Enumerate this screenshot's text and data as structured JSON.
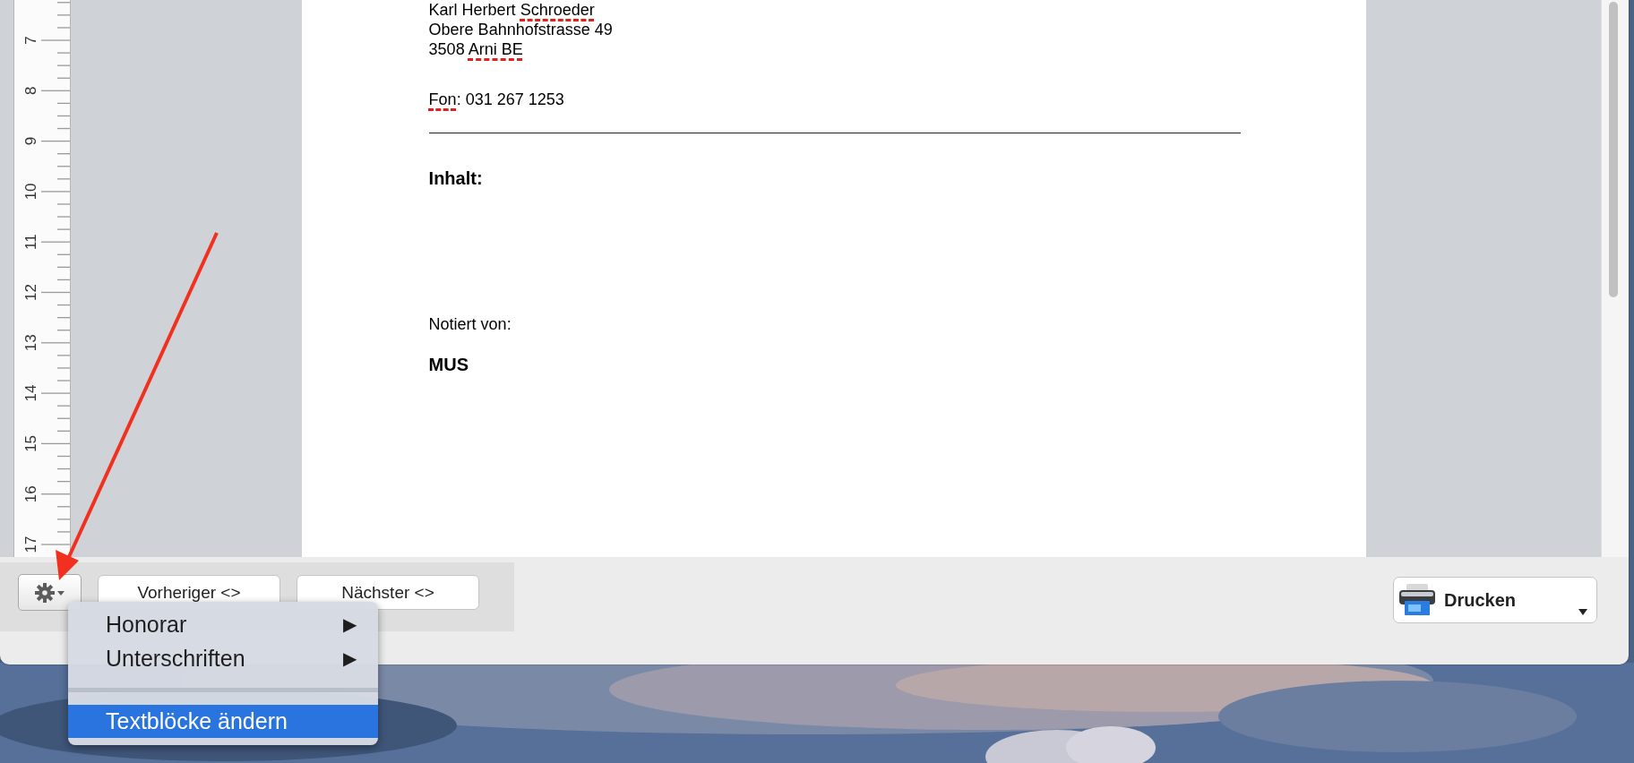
{
  "ruler": {
    "labels": [
      "7",
      "8",
      "9",
      "10",
      "11",
      "12",
      "13",
      "14",
      "15",
      "16",
      "17"
    ]
  },
  "document": {
    "blocks": [
      {
        "kind": "line",
        "segments": [
          {
            "text": "Karl Herbert ",
            "misspelled": false
          },
          {
            "text": "Schroeder",
            "misspelled": true
          }
        ]
      },
      {
        "kind": "line",
        "segments": [
          {
            "text": "Obere Bahnhofstrasse 49",
            "misspelled": false
          }
        ]
      },
      {
        "kind": "line",
        "segments": [
          {
            "text": "3508 ",
            "misspelled": false
          },
          {
            "text": "Arni BE",
            "misspelled": true
          }
        ]
      },
      {
        "kind": "line",
        "segments": [
          {
            "text": "Fon",
            "misspelled": true
          },
          {
            "text": ": 031 267 1253",
            "misspelled": false
          }
        ]
      },
      {
        "kind": "rule"
      },
      {
        "kind": "heading",
        "text": "Inhalt:"
      },
      {
        "kind": "line",
        "segments": [
          {
            "text": "Notiert von:",
            "misspelled": false
          }
        ]
      },
      {
        "kind": "heading",
        "text": "MUS"
      }
    ]
  },
  "toolbar": {
    "buttons": [
      "Vorheriger <>",
      "Nächster <>"
    ],
    "print_button": "Drucken"
  },
  "menu": {
    "items": [
      {
        "kind": "item",
        "label": "Honorar",
        "submenu": true,
        "selected": false
      },
      {
        "kind": "item",
        "label": "Unterschriften",
        "submenu": true,
        "selected": false
      },
      {
        "kind": "separator"
      },
      {
        "kind": "item",
        "label": "Textblöcke ändern",
        "submenu": false,
        "selected": true
      }
    ]
  },
  "submenu_glyph": "▶"
}
